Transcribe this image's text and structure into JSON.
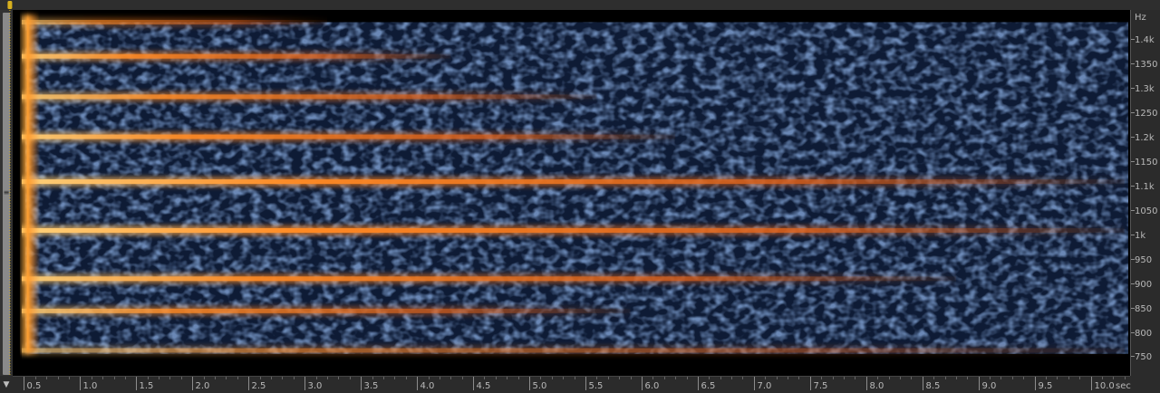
{
  "chart_data": {
    "type": "heatmap",
    "title": "",
    "x_axis": {
      "unit_label": "sec",
      "range": [
        0.4,
        10.35
      ],
      "ticks": [
        0.5,
        1.0,
        1.5,
        2.0,
        2.5,
        3.0,
        3.5,
        4.0,
        4.5,
        5.0,
        5.5,
        6.0,
        6.5,
        7.0,
        7.5,
        8.0,
        8.5,
        9.0,
        9.5,
        10.0
      ],
      "tick_labels": [
        "0.5",
        "1.0",
        "1.5",
        "2.0",
        "2.5",
        "3.0",
        "3.5",
        "4.0",
        "4.5",
        "5.0",
        "5.5",
        "6.0",
        "6.5",
        "7.0",
        "7.5",
        "8.0",
        "8.5",
        "9.0",
        "9.5",
        "10.0"
      ]
    },
    "y_axis": {
      "unit_label": "Hz",
      "range": [
        710,
        1460
      ],
      "ticks": [
        750,
        800,
        850,
        900,
        950,
        1000,
        1050,
        1100,
        1150,
        1200,
        1250,
        1300,
        1350,
        1400
      ],
      "tick_labels": [
        "750",
        "800",
        "850",
        "900",
        "950",
        "1k",
        "1050",
        "1.1k",
        "1150",
        "1.2k",
        "1250",
        "1.3k",
        "1350",
        "1.4k"
      ]
    },
    "onset_sec": 0.48,
    "noise_floor_hz_range": [
      755,
      1435
    ],
    "partials": [
      {
        "freq_hz": 1435,
        "end_sec": 3.2,
        "intensity": 0.55
      },
      {
        "freq_hz": 1365,
        "end_sec": 4.3,
        "intensity": 0.85
      },
      {
        "freq_hz": 1282,
        "end_sec": 5.6,
        "intensity": 0.8
      },
      {
        "freq_hz": 1200,
        "end_sec": 6.3,
        "intensity": 0.9
      },
      {
        "freq_hz": 1108,
        "end_sec": 10.3,
        "intensity": 0.95
      },
      {
        "freq_hz": 1008,
        "end_sec": 10.3,
        "intensity": 1.0
      },
      {
        "freq_hz": 909,
        "end_sec": 8.8,
        "intensity": 0.88
      },
      {
        "freq_hz": 843,
        "end_sec": 5.9,
        "intensity": 0.75
      },
      {
        "freq_hz": 762,
        "end_sec": 10.3,
        "intensity": 0.45
      }
    ],
    "colormap": [
      "#000000",
      "#0d2140",
      "#2f4f8a",
      "#ff7a1a",
      "#ffd070"
    ]
  },
  "colors": {
    "background": "#000000",
    "panel": "#2b2b2b",
    "axis_text": "#b8b8b8",
    "tick": "#8c8c8c",
    "playhead": "#d8b01e"
  }
}
